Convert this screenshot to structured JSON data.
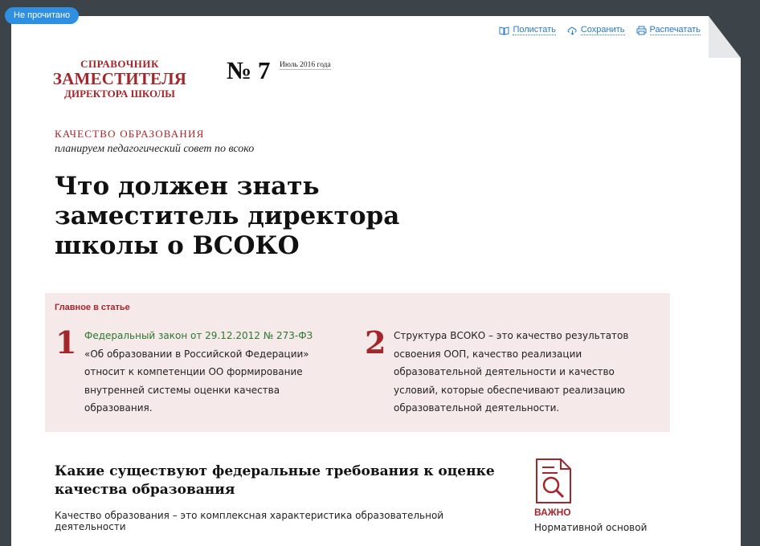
{
  "badge": "Не прочитано",
  "toolbar": {
    "read": "Полистать",
    "save": "Сохранить",
    "print": "Распечатать"
  },
  "logo": {
    "line1": "СПРАВОЧНИК",
    "line2": "ЗАМЕСТИТЕЛЯ",
    "line3": "ДИРЕКТОРА ШКОЛЫ"
  },
  "issue": {
    "number": "№ 7",
    "date": "Июль 2016 года"
  },
  "article": {
    "rubric": "КАЧЕСТВО ОБРАЗОВАНИЯ",
    "subrubric": "планируем педагогический совет по всоко",
    "title": "Что должен знать заместитель директора школы о ВСОКО"
  },
  "summary": {
    "title": "Главное в статье",
    "items": [
      {
        "num": "1",
        "link": "Федеральный закон от 29.12.2012 № 273-ФЗ",
        "text": "«Об образовании в Российской Федерации» относит к компетенции ОО формирование внутренней системы оценки качества образования."
      },
      {
        "num": "2",
        "text": "Структура ВСОКО – это качество результатов освоения ООП, качество реализации образовательной деятельности и качество условий, которые обеспечивают реализацию образовательной деятельности."
      }
    ]
  },
  "section": {
    "title": "Какие существуют федеральные требования к оценке качества образования",
    "text": "Качество образования – это комплексная характеристика образовательной деятельности"
  },
  "sidebar": {
    "label": "ВАЖНО",
    "text": "Нормативной основой"
  },
  "colors": {
    "accent": "#a3262a",
    "link": "#2a78c8",
    "summary_bg": "#f5e9ea",
    "badge": "#2f8fe0"
  }
}
